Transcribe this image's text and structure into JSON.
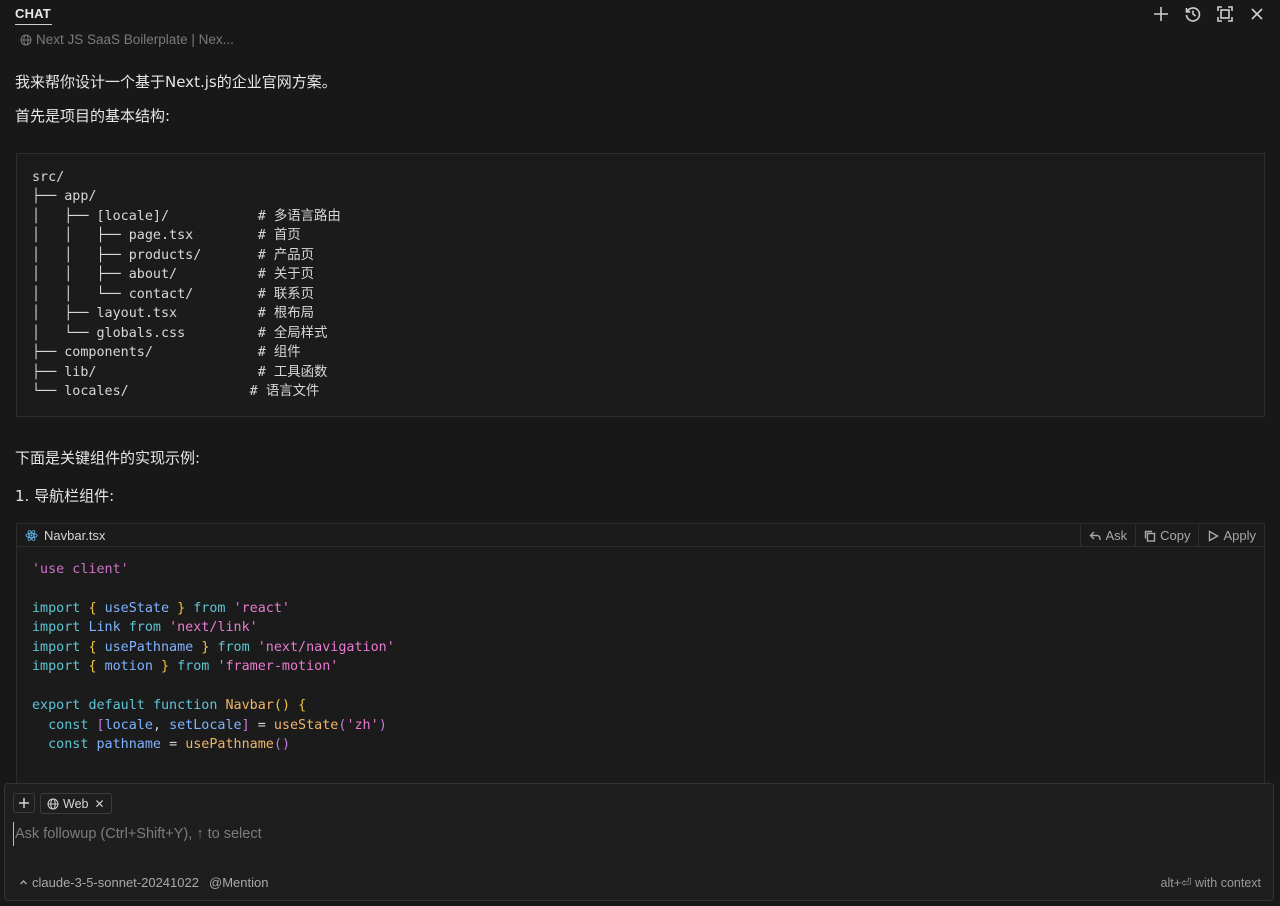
{
  "header": {
    "tab": "CHAT",
    "icons": [
      "plus-icon",
      "history-icon",
      "maximize-icon",
      "close-icon"
    ]
  },
  "context_chip": "Next JS SaaS Boilerplate | Nex...",
  "messages": {
    "intro": "我来帮你设计一个基于Next.js的企业官网方案。",
    "structure_heading": "首先是项目的基本结构:",
    "components_heading": "下面是关键组件的实现示例:",
    "navbar_heading": "1. 导航栏组件:"
  },
  "file_tree": [
    {
      "line": "src/",
      "comment": ""
    },
    {
      "line": "├── app/",
      "comment": ""
    },
    {
      "line": "│   ├── [locale]/",
      "comment": "多语言路由"
    },
    {
      "line": "│   │   ├── page.tsx",
      "comment": "首页"
    },
    {
      "line": "│   │   ├── products/",
      "comment": "产品页"
    },
    {
      "line": "│   │   ├── about/",
      "comment": "关于页"
    },
    {
      "line": "│   │   └── contact/",
      "comment": "联系页"
    },
    {
      "line": "│   ├── layout.tsx",
      "comment": "根布局"
    },
    {
      "line": "│   └── globals.css",
      "comment": "全局样式"
    },
    {
      "line": "├── components/",
      "comment": "组件"
    },
    {
      "line": "├── lib/",
      "comment": "工具函数"
    },
    {
      "line": "└── locales/",
      "comment": "语言文件"
    }
  ],
  "code_block": {
    "filename": "Navbar.tsx",
    "actions": {
      "ask": "Ask",
      "copy": "Copy",
      "apply": "Apply"
    },
    "lines": [
      "'use client'",
      "",
      "import { useState } from 'react'",
      "import Link from 'next/link'",
      "import { usePathname } from 'next/navigation'",
      "import { motion } from 'framer-motion'",
      "",
      "export default function Navbar() {",
      "  const [locale, setLocale] = useState('zh')",
      "  const pathname = usePathname()"
    ]
  },
  "composer": {
    "web_pill": "Web",
    "placeholder": "Ask followup (Ctrl+Shift+Y), ↑ to select",
    "model": "claude-3-5-sonnet-20241022",
    "mention": "@Mention",
    "hint": "alt+⏎ with context"
  }
}
